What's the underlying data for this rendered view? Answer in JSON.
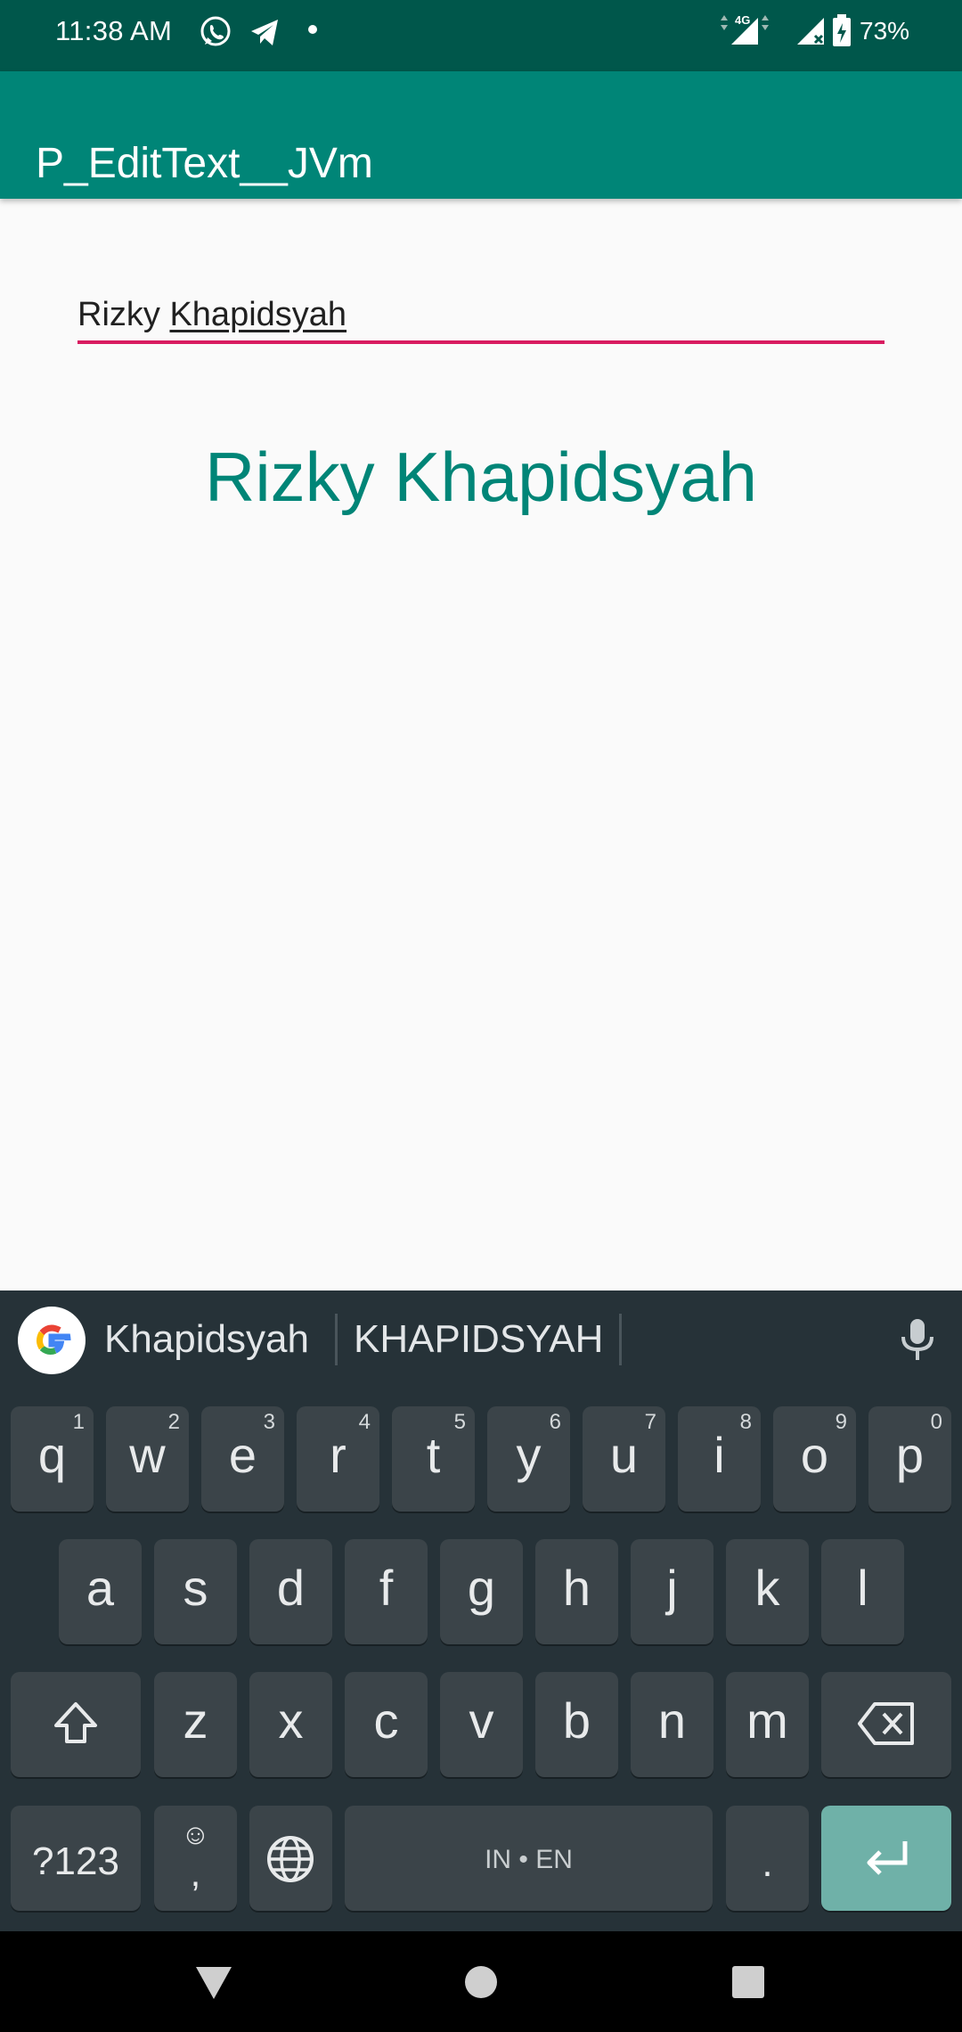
{
  "status_bar": {
    "time": "11:38 AM",
    "notification_icons": [
      "whatsapp-icon",
      "telegram-icon",
      "dot-icon"
    ],
    "system_icons": [
      "4g-signal-icon",
      "signal-no-data-icon",
      "battery-icon"
    ],
    "network_label": "4G",
    "battery": "73%"
  },
  "app_bar": {
    "title": "P_EditText__JVm"
  },
  "edit_text": {
    "plain": "Rizky ",
    "composing": "Khapidsyah"
  },
  "display_text": "Rizky Khapidsyah",
  "keyboard": {
    "suggestions": [
      "Khapidsyah",
      "KHAPIDSYAH"
    ],
    "row1": [
      {
        "key": "q",
        "hint": "1"
      },
      {
        "key": "w",
        "hint": "2"
      },
      {
        "key": "e",
        "hint": "3"
      },
      {
        "key": "r",
        "hint": "4"
      },
      {
        "key": "t",
        "hint": "5"
      },
      {
        "key": "y",
        "hint": "6"
      },
      {
        "key": "u",
        "hint": "7"
      },
      {
        "key": "i",
        "hint": "8"
      },
      {
        "key": "o",
        "hint": "9"
      },
      {
        "key": "p",
        "hint": "0"
      }
    ],
    "row2": [
      "a",
      "s",
      "d",
      "f",
      "g",
      "h",
      "j",
      "k",
      "l"
    ],
    "row3": [
      "z",
      "x",
      "c",
      "v",
      "b",
      "n",
      "m"
    ],
    "symbols_label": "?123",
    "emoji_label": "☺",
    "comma_label": ",",
    "space_label": "IN • EN",
    "period_label": ".",
    "icons": [
      "google-g-icon",
      "mic-icon",
      "shift-icon",
      "backspace-icon",
      "globe-icon",
      "enter-icon"
    ]
  },
  "nav_bar": {
    "buttons": [
      "back",
      "home",
      "recents"
    ]
  },
  "colors": {
    "status_bar": "#00574b",
    "app_bar": "#008577",
    "accent": "#d81b60",
    "keyboard_bg": "#263238",
    "key_bg": "#3b4449",
    "enter_key": "#6fb1a8"
  }
}
